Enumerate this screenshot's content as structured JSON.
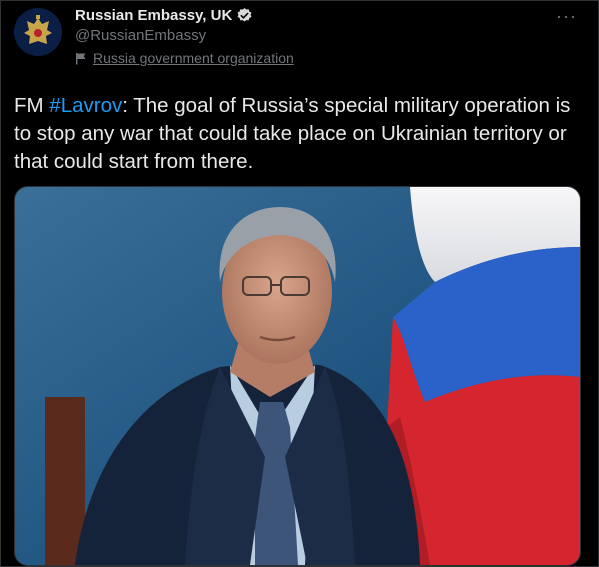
{
  "account": {
    "display_name": "Russian Embassy, UK",
    "handle": "@RussianEmbassy",
    "label": "Russia government organization",
    "avatar_icon": "coat-of-arms-icon",
    "verified_icon": "verified-badge-icon"
  },
  "menu": {
    "more_label": "···"
  },
  "tweet": {
    "prefix": "FM ",
    "hashtag": "#Lavrov",
    "body": ": The goal of Russia’s special military operation is to stop any war that could take place on Ukrainian territory or that could start from there."
  },
  "colors": {
    "background": "#000000",
    "text": "#e7e9ea",
    "secondary": "#71767b",
    "link": "#1d9bf0",
    "flag_white": "#f2f2f4",
    "flag_blue": "#2a62c9",
    "flag_red": "#d5262f"
  }
}
